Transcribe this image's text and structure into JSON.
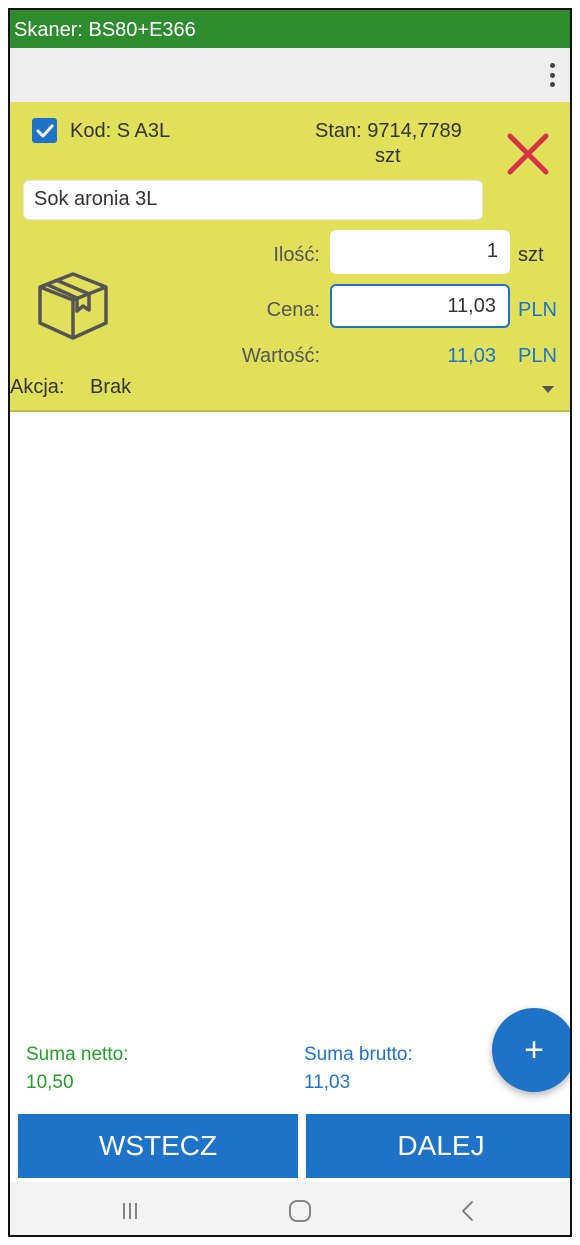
{
  "app": {
    "title": "Skaner: BS80+E366"
  },
  "item": {
    "code": "Kod: S A3L",
    "stock_label": "Stan:",
    "stock_value": "9714,7789",
    "stock_unit": "szt",
    "name": "Sok aronia 3L",
    "quantity_label": "Ilość:",
    "quantity_value": "1",
    "quantity_unit": "szt",
    "price_label": "Cena:",
    "price_value": "11,03",
    "price_unit": "PLN",
    "value_label": "Wartość:",
    "value_value": "11,03",
    "value_unit": "PLN",
    "checkbox_checked": true
  },
  "action": {
    "label": "Akcja:",
    "value": "Brak"
  },
  "summary": {
    "netto_label": "Suma netto:",
    "netto_value": "10,50",
    "brutto_label": "Suma brutto:",
    "brutto_value": "11,03"
  },
  "buttons": {
    "back_label": "WSTECZ",
    "next_label": "DALEJ",
    "fab_label": "+"
  },
  "colors": {
    "title_bar": "#2e8b2e",
    "card_background": "#e0e05a",
    "accent": "#1e73c8",
    "netto_text": "#22a02a",
    "close_icon": "#d6334a"
  },
  "icons": {
    "menu": "more-vert-icon",
    "close": "close-icon",
    "product": "package-box-icon",
    "check": "checkbox-checked-icon",
    "nav_recent": "recent-apps-icon",
    "nav_home": "home-icon",
    "nav_back": "back-icon"
  }
}
